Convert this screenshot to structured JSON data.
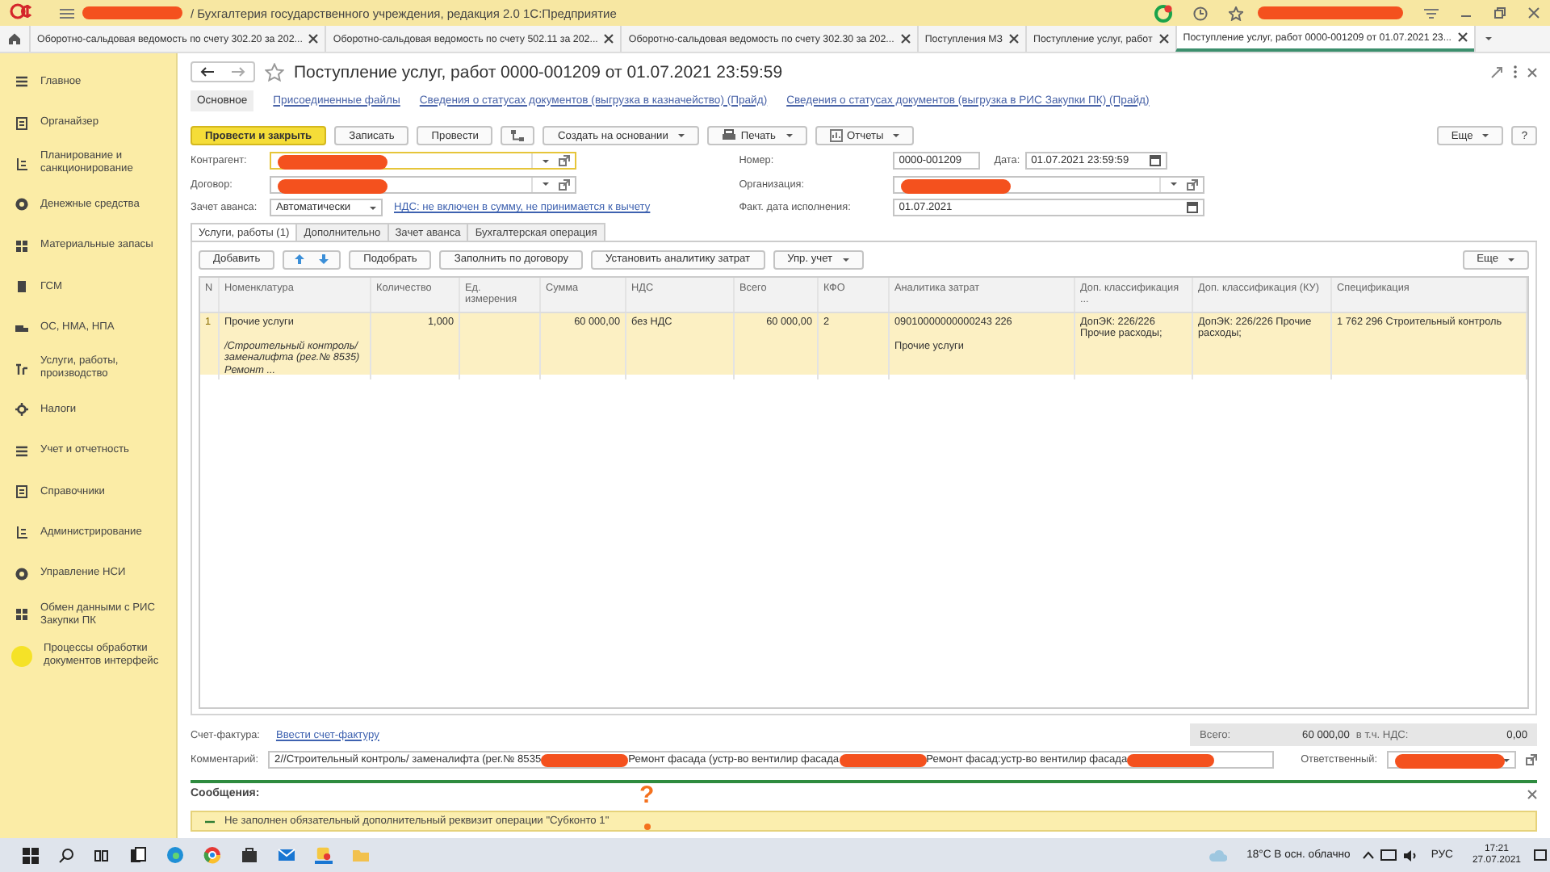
{
  "title_bar": {
    "parts": [
      {
        "kind": "redaction"
      },
      {
        "kind": "text",
        "text": "/ Бухгалтерия государственного учреждения, редакция 2.0 1С:Предприятие"
      }
    ],
    "user_redacted": true
  },
  "open_tabs": [
    {
      "label": "Оборотно-сальдовая ведомость по счету 302.20 за 202...",
      "selected": false
    },
    {
      "label": "Оборотно-сальдовая ведомость по счету 502.11 за 202...",
      "selected": false
    },
    {
      "label": "Оборотно-сальдовая ведомость по счету 302.30 за 202...",
      "selected": false
    },
    {
      "label": "Поступления МЗ",
      "selected": false
    },
    {
      "label": "Поступление услуг, работ",
      "selected": false
    },
    {
      "label": "Поступление услуг, работ 0000-001209 от 01.07.2021 23...",
      "selected": true
    }
  ],
  "sidebar": {
    "items": [
      {
        "label": "Главное"
      },
      {
        "label": "Органайзер"
      },
      {
        "label": "Планирование и санкционирование"
      },
      {
        "label": "Денежные средства"
      },
      {
        "label": "Материальные запасы"
      },
      {
        "label": "ГСМ"
      },
      {
        "label": "ОС, НМА, НПА"
      },
      {
        "label": "Услуги, работы, производство"
      },
      {
        "label": "Налоги"
      },
      {
        "label": "Учет и отчетность"
      },
      {
        "label": "Справочники"
      },
      {
        "label": "Администрирование"
      },
      {
        "label": "Управление НСИ"
      },
      {
        "label": "Обмен данными с РИС Закупки ПК"
      },
      {
        "label": "Процессы обработки документов интерфейс"
      }
    ]
  },
  "document": {
    "title": "Поступление услуг, работ 0000-001209 от 01.07.2021 23:59:59",
    "sections": [
      {
        "label": "Основное",
        "selected": true
      },
      {
        "label": "Присоединенные файлы",
        "selected": false
      },
      {
        "label": "Сведения о статусах документов (выгрузка в казначейство) (Прайд)",
        "selected": false
      },
      {
        "label": "Сведения о статусах документов (выгрузка в РИС Закупки ПК) (Прайд)",
        "selected": false
      }
    ],
    "toolbar": [
      {
        "kind": "primary",
        "label": "Провести и закрыть"
      },
      {
        "kind": "plain",
        "label": "Записать"
      },
      {
        "kind": "plain",
        "label": "Провести"
      },
      {
        "kind": "icon"
      },
      {
        "kind": "menu",
        "label": "Создать на основании"
      },
      {
        "kind": "print",
        "label": "Печать"
      },
      {
        "kind": "report",
        "label": "Отчеты"
      }
    ],
    "more_button": "Еще",
    "help_button": "?",
    "left_fields": [
      {
        "label": "Контрагент:",
        "redacted": true,
        "focused": true
      },
      {
        "label": "Договор:",
        "redacted": true,
        "focused": false
      }
    ],
    "advance": {
      "label": "Зачет аванса:",
      "value": "Автоматически",
      "vat_link": "НДС: не включен в сумму, не принимается к вычету"
    },
    "number": {
      "label": "Номер:",
      "value": "0000-001209"
    },
    "date": {
      "label": "Дата:",
      "value": "01.07.2021 23:59:59"
    },
    "organization": {
      "label": "Организация:",
      "redacted": true
    },
    "fact_date": {
      "label": "Факт. дата исполнения:",
      "value": "01.07.2021"
    },
    "inner_tabs": [
      {
        "label": "Услуги, работы (1)",
        "selected": true
      },
      {
        "label": "Дополнительно",
        "selected": false
      },
      {
        "label": "Зачет аванса",
        "selected": false
      },
      {
        "label": "Бухгалтерская операция",
        "selected": false
      }
    ],
    "table_toolbar": [
      {
        "kind": "plain",
        "label": "Добавить"
      },
      {
        "kind": "arrows"
      },
      {
        "kind": "plain",
        "label": "Подобрать"
      },
      {
        "kind": "plain",
        "label": "Заполнить по договору"
      },
      {
        "kind": "plain",
        "label": "Установить аналитику затрат"
      },
      {
        "kind": "menu",
        "label": "Упр. учет"
      }
    ],
    "table_more": "Еще",
    "table": {
      "columns": [
        "N",
        "Номенклатура",
        "Количество",
        "Ед. измерения",
        "Сумма",
        "НДС",
        "Всего",
        "КФО",
        "Аналитика затрат",
        "Доп. классификация ...",
        "Доп. классификация (КУ)",
        "Спецификация"
      ],
      "rows": [
        {
          "selected": true,
          "cells": [
            "1",
            "Прочие услуги\n\n*/Строительный контроль/ заменалифта (рег.№ 8535)*\n*Ремонт ...*",
            "1,000",
            "",
            "60 000,00",
            "без НДС",
            "60 000,00",
            "2",
            "09010000000000243    226\n\nПрочие услуги",
            "ДопЭК: 226/226 Прочие расходы;",
            "ДопЭК: 226/226 Прочие расходы;",
            "1 762 296 Строительный контроль"
          ]
        }
      ]
    },
    "invoice": {
      "label": "Счет-фактура:",
      "link": "Ввести счет-фактуру"
    },
    "totals": [
      {
        "label": "Всего:",
        "value": "60 000,00"
      },
      {
        "label": "в т.ч. НДС:",
        "value": "0,00"
      }
    ],
    "comment": {
      "label": "Комментарий:",
      "parts": [
        {
          "kind": "text",
          "text": "2//Строительный контроль/ заменалифта (рег.№ 8535"
        },
        {
          "kind": "redaction"
        },
        {
          "kind": "text",
          "text": "Ремонт фасада (устр-во вентилир фасада"
        },
        {
          "kind": "redaction"
        },
        {
          "kind": "text",
          "text": "Ремонт фасад:"
        },
        {
          "kind": "text",
          "text": "устр-во вентилир фасада"
        },
        {
          "kind": "redaction"
        }
      ]
    },
    "responsible": {
      "label": "Ответственный:",
      "redacted": true
    }
  },
  "messages": {
    "title": "Сообщения:",
    "items": [
      "Не заполнен обязательный дополнительный реквизит операции \"Субконто 1\""
    ]
  },
  "annotation": {
    "text": "?"
  },
  "taskbar": {
    "weather": "18°C  В осн. облачно",
    "language": "РУС",
    "time": "17:21",
    "date": "27.07.2021"
  }
}
